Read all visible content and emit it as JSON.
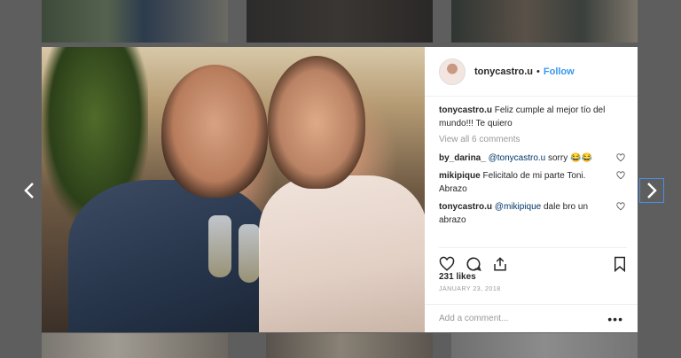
{
  "post": {
    "username": "tonycastro.u",
    "follow_label": "Follow",
    "separator": "•",
    "caption": "Feliz cumple al mejor tío del mundo!!! Te quiero",
    "view_all_label": "View all 6 comments",
    "comments": [
      {
        "user": "by_darina_",
        "mention": "@tonycastro.u",
        "text": " sorry 😂😂"
      },
      {
        "user": "mikipique",
        "mention": "",
        "text": " Felicitalo de mi parte Toni. Abrazo"
      },
      {
        "user": "tonycastro.u",
        "mention": "@mikipique",
        "text": " dale bro un abrazo"
      }
    ],
    "likes": "231 likes",
    "date": "JANUARY 23, 2018",
    "add_comment_placeholder": "Add a comment...",
    "more_label": "•••"
  },
  "icons": {
    "like": "heart-icon",
    "comment": "comment-icon",
    "share": "share-icon",
    "save": "bookmark-icon",
    "prev": "chevron-left-icon",
    "next": "chevron-right-icon"
  },
  "colors": {
    "overlay": "#5e5e5e",
    "link": "#3897f0",
    "text": "#262626",
    "muted": "#999999"
  }
}
